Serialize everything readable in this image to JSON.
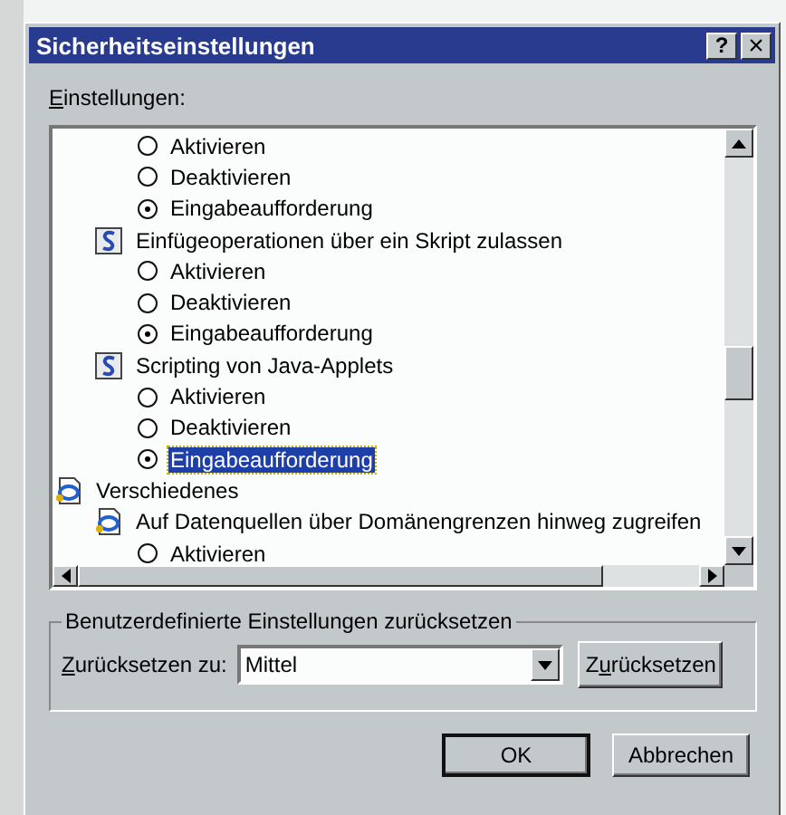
{
  "window": {
    "title": "Sicherheitseinstellungen",
    "title_buttons": [
      {
        "kind": "help",
        "label": "?"
      },
      {
        "kind": "close",
        "label": "×"
      }
    ]
  },
  "settings_label": {
    "access_key": "E",
    "text_after": "instellungen:"
  },
  "tree": [
    {
      "children": [
        {
          "children": [
            {
              "kind": "option",
              "label": "Aktivieren",
              "selected": false,
              "highlighted": false
            },
            {
              "kind": "option",
              "label": "Deaktivieren",
              "selected": false,
              "highlighted": false
            },
            {
              "kind": "option",
              "label": "Eingabeaufforderung",
              "selected": true,
              "highlighted": false
            }
          ]
        },
        {
          "kind": "setting",
          "label": "Einfügeoperationen über ein Skript zulassen",
          "children": [
            {
              "kind": "option",
              "label": "Aktivieren",
              "selected": false,
              "highlighted": false
            },
            {
              "kind": "option",
              "label": "Deaktivieren",
              "selected": false,
              "highlighted": false
            },
            {
              "kind": "option",
              "label": "Eingabeaufforderung",
              "selected": true,
              "highlighted": false
            }
          ]
        },
        {
          "kind": "setting",
          "label": "Scripting von Java-Applets",
          "children": [
            {
              "kind": "option",
              "label": "Aktivieren",
              "selected": false,
              "highlighted": false
            },
            {
              "kind": "option",
              "label": "Deaktivieren",
              "selected": false,
              "highlighted": false
            },
            {
              "kind": "option",
              "label": "Eingabeaufforderung",
              "selected": true,
              "highlighted": true
            }
          ]
        }
      ]
    },
    {
      "kind": "category",
      "label": "Verschiedenes",
      "children": [
        {
          "kind": "page",
          "label": "Auf Datenquellen über Domänengrenzen hinweg zugreifen",
          "children": [
            {
              "kind": "option",
              "label": "Aktivieren",
              "selected": false,
              "highlighted": false
            }
          ]
        }
      ]
    }
  ],
  "reset_group": {
    "title": "Benutzerdefinierte Einstellungen zurücksetzen",
    "label": {
      "access_key": "Z",
      "text_after": "urücksetzen zu:"
    },
    "select": {
      "value": "Mittel"
    },
    "button": {
      "text_before": "Z",
      "access_key": "u",
      "text_after": "rücksetzen"
    }
  },
  "buttons": [
    {
      "label": "OK",
      "default": true
    },
    {
      "label": "Abbrechen",
      "default": false
    }
  ]
}
